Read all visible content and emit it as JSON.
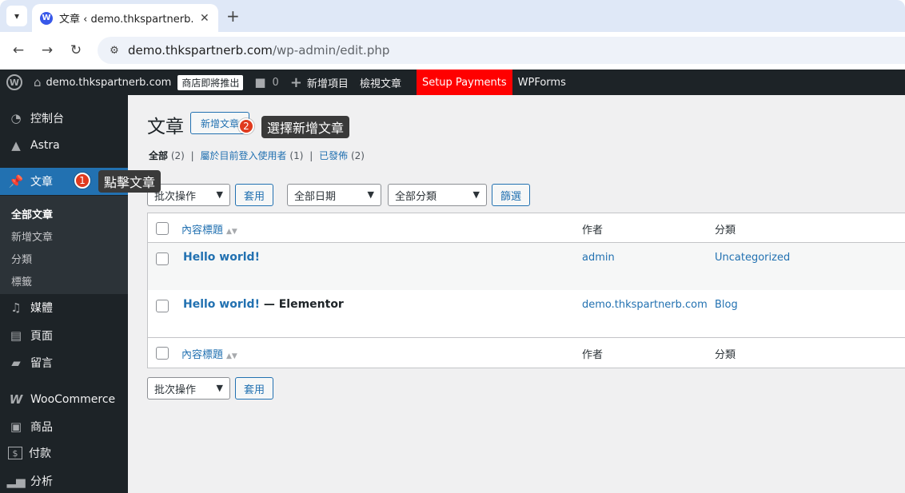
{
  "browser": {
    "tab_title": "文章 ‹ demo.thkspartnerb.com",
    "url_host": "demo.thkspartnerb.com",
    "url_path": "/wp-admin/edit.php"
  },
  "adminbar": {
    "site_name": "demo.thkspartnerb.com",
    "store_badge": "商店即將推出",
    "comments_count": "0",
    "new_item": "新增項目",
    "view_posts": "檢視文章",
    "setup_payments": "Setup Payments",
    "wpforms": "WPForms"
  },
  "sidebar": {
    "items": [
      {
        "label": "控制台",
        "icon": "dashboard-icon"
      },
      {
        "label": "Astra",
        "icon": "astra-icon"
      },
      {
        "label": "文章",
        "icon": "pin-icon"
      },
      {
        "label": "媒體",
        "icon": "media-icon"
      },
      {
        "label": "頁面",
        "icon": "page-icon"
      },
      {
        "label": "留言",
        "icon": "comment-icon"
      },
      {
        "label": "WooCommerce",
        "icon": "woo-icon"
      },
      {
        "label": "商品",
        "icon": "archive-icon"
      },
      {
        "label": "付款",
        "icon": "dollar-icon"
      },
      {
        "label": "分析",
        "icon": "chart-icon"
      }
    ],
    "submenu": [
      "全部文章",
      "新增文章",
      "分類",
      "標籤"
    ]
  },
  "main": {
    "title": "文章",
    "add_new": "新增文章",
    "filters": {
      "all": "全部",
      "all_count": "(2)",
      "mine": "屬於目前登入使用者",
      "mine_count": "(1)",
      "published": "已發佈",
      "published_count": "(2)",
      "sep": "|"
    },
    "bulk_action": "批次操作",
    "apply": "套用",
    "all_dates": "全部日期",
    "all_categories": "全部分類",
    "filter": "篩選",
    "columns": {
      "title": "內容標題",
      "author": "作者",
      "category": "分類"
    },
    "rows": [
      {
        "title": "Hello world!",
        "suffix": "",
        "author": "admin",
        "category": "Uncategorized"
      },
      {
        "title": "Hello world!",
        "suffix": " — Elementor",
        "author": "demo.thkspartnerb.com",
        "category": "Blog"
      }
    ]
  },
  "callouts": [
    {
      "num": "1",
      "text": "點擊文章"
    },
    {
      "num": "2",
      "text": "選擇新增文章"
    }
  ],
  "colors": {
    "accent": "#2271b1",
    "admin_bar": "#1d2327",
    "setup_payments": "#ff0000",
    "callout_badge": "#e03a1e"
  }
}
